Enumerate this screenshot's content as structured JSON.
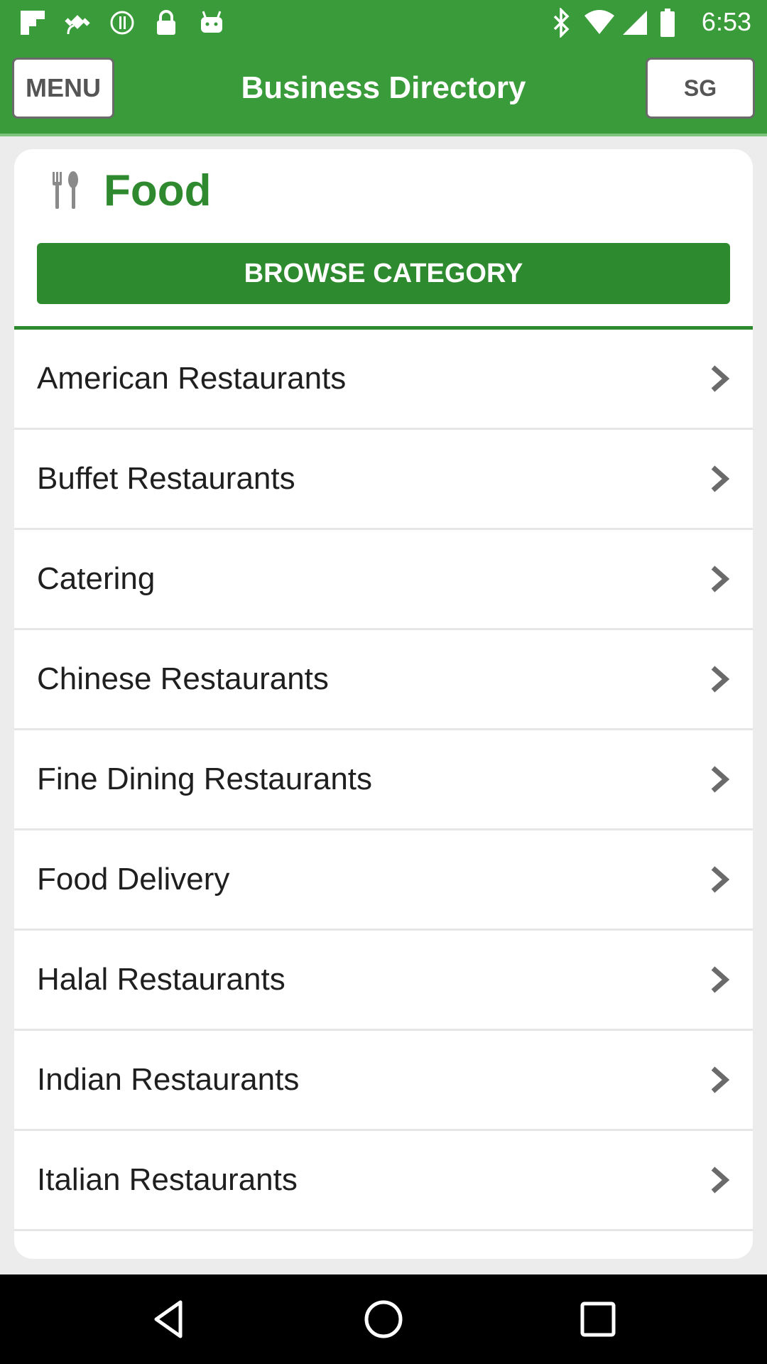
{
  "status_bar": {
    "time": "6:53",
    "background_color": "#3a9b3a",
    "icons": [
      "flipboard-icon",
      "fake-gps-icon",
      "circle-status-icon",
      "lock-icon",
      "android-icon",
      "bluetooth-icon",
      "wifi-icon",
      "signal-icon",
      "battery-icon"
    ]
  },
  "app_bar": {
    "menu_label": "MENU",
    "title": "Business Directory",
    "region_label": "SG",
    "background_color": "#3a9b3a"
  },
  "category": {
    "icon": "fork-knife-icon",
    "title": "Food",
    "browse_label": "BROWSE CATEGORY",
    "accent_color": "#2e8a2e"
  },
  "list": {
    "items": [
      {
        "label": "American Restaurants"
      },
      {
        "label": "Buffet Restaurants"
      },
      {
        "label": "Catering"
      },
      {
        "label": "Chinese Restaurants"
      },
      {
        "label": "Fine Dining Restaurants"
      },
      {
        "label": "Food Delivery"
      },
      {
        "label": "Halal Restaurants"
      },
      {
        "label": "Indian Restaurants"
      },
      {
        "label": "Italian Restaurants"
      }
    ]
  },
  "nav_bar": {
    "buttons": [
      "back-icon",
      "home-icon",
      "recents-icon"
    ]
  }
}
